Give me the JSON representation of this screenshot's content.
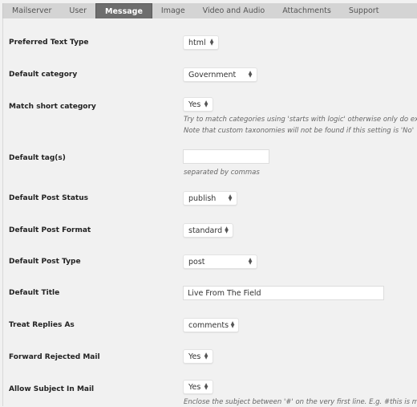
{
  "tabs": [
    {
      "label": "Mailserver",
      "active": false
    },
    {
      "label": "User",
      "active": false
    },
    {
      "label": "Message",
      "active": true
    },
    {
      "label": "Image",
      "active": false
    },
    {
      "label": "Video and Audio",
      "active": false
    },
    {
      "label": "Attachments",
      "active": false
    },
    {
      "label": "Support",
      "active": false
    }
  ],
  "fields": {
    "preferred_text_type": {
      "label": "Preferred Text Type",
      "value": "html"
    },
    "default_category": {
      "label": "Default category",
      "value": "Government"
    },
    "match_short_category": {
      "label": "Match short category",
      "value": "Yes",
      "hint_line1": "Try to match categories using 'starts with logic' otherwise only do exact matches",
      "hint_line2": "Note that custom taxonomies will not be found if this setting is 'No'"
    },
    "default_tags": {
      "label": "Default tag(s)",
      "value": "",
      "hint": "separated by commas"
    },
    "default_post_status": {
      "label": "Default Post Status",
      "value": "publish"
    },
    "default_post_format": {
      "label": "Default Post Format",
      "value": "standard"
    },
    "default_post_type": {
      "label": "Default Post Type",
      "value": "post"
    },
    "default_title": {
      "label": "Default Title",
      "value": "Live From The Field"
    },
    "treat_replies_as": {
      "label": "Treat Replies As",
      "value": "comments"
    },
    "forward_rejected_mail": {
      "label": "Forward Rejected Mail",
      "value": "Yes"
    },
    "allow_subject_in_mail": {
      "label": "Allow Subject In Mail",
      "value": "Yes",
      "hint": "Enclose the subject between '#' on the very first line. E.g. #this is my subject#"
    }
  },
  "colors": {
    "active_tab_bg": "#6d6d6d",
    "tabbar_bg": "#d4d4d4",
    "page_bg": "#f1f1f1"
  }
}
